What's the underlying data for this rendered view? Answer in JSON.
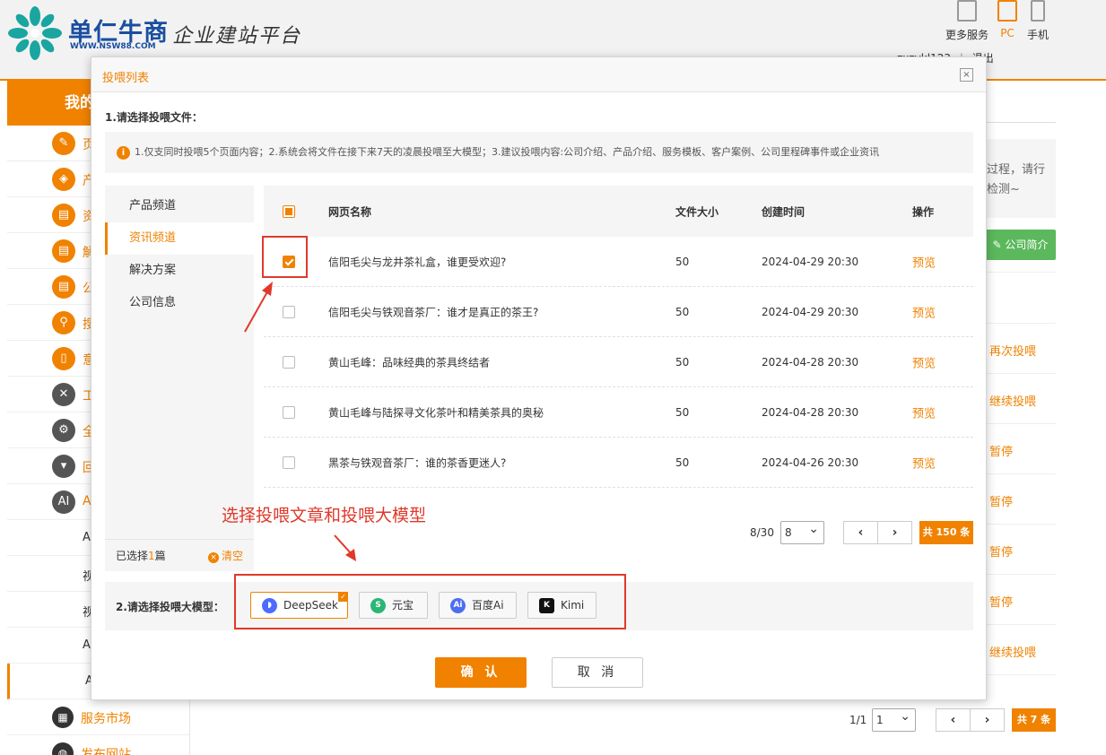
{
  "header": {
    "brand": "单仁牛商",
    "url": "WWW.NSW88.COM",
    "slogan": "企业建站平台",
    "devices": [
      {
        "label": "更多服务",
        "active": false
      },
      {
        "label": "PC",
        "active": true
      },
      {
        "label": "手机",
        "active": false
      }
    ],
    "user": "zxzykl123",
    "logout": "退出"
  },
  "sidebar": {
    "title": "我的",
    "items": [
      {
        "label": "页",
        "icon": "pencil-icon"
      },
      {
        "label": "产",
        "icon": "box-icon"
      },
      {
        "label": "资",
        "icon": "document-icon"
      },
      {
        "label": "解",
        "icon": "document-icon"
      },
      {
        "label": "公",
        "icon": "document-icon"
      },
      {
        "label": "搜",
        "icon": "search-icon"
      },
      {
        "label": "意",
        "icon": "file-icon"
      },
      {
        "label": "工",
        "icon": "wrench-icon"
      },
      {
        "label": "全",
        "icon": "gear-icon"
      },
      {
        "label": "回",
        "icon": "trash-icon"
      },
      {
        "label": "A",
        "icon": "ai-icon"
      }
    ],
    "subitems": [
      "A",
      "视",
      "视",
      "A",
      "A"
    ],
    "footer": [
      {
        "label": "服务市场",
        "icon": "grid-icon"
      },
      {
        "label": "发布网站",
        "icon": "globe-icon"
      }
    ]
  },
  "background": {
    "notice": "过程，请行检测~",
    "green_button": "公司简介",
    "actions": [
      "再次投喂",
      "继续投喂",
      "暂停",
      "暂停",
      "暂停",
      "暂停",
      "继续投喂"
    ],
    "pager": {
      "page": "1/1",
      "select": "1",
      "total": "共 7 条"
    }
  },
  "modal": {
    "title": "投喂列表",
    "close": "×",
    "step1": "1.请选择投喂文件：",
    "tip": "1.仅支同时投喂5个页面内容；2.系统会将文件在接下来7天的凌晨投喂至大模型；3.建议投喂内容:公司介绍、产品介绍、服务模板、客户案例、公司里程碑事件或企业资讯",
    "categories": [
      {
        "label": "产品频道",
        "active": false
      },
      {
        "label": "资讯频道",
        "active": true
      },
      {
        "label": "解决方案",
        "active": false
      },
      {
        "label": "公司信息",
        "active": false
      }
    ],
    "selected_prefix": "已选择",
    "selected_count": "1",
    "selected_suffix": "篇",
    "clear": "清空",
    "columns": {
      "name": "网页名称",
      "size": "文件大小",
      "time": "创建时间",
      "op": "操作"
    },
    "rows": [
      {
        "name": "信阳毛尖与龙井茶礼盒，谁更受欢迎?",
        "size": "50",
        "time": "2024-04-29 20:30",
        "op": "预览",
        "checked": true
      },
      {
        "name": "信阳毛尖与铁观音茶厂：谁才是真正的茶王?",
        "size": "50",
        "time": "2024-04-29 20:30",
        "op": "预览",
        "checked": false
      },
      {
        "name": "黄山毛峰：品味经典的茶具终结者",
        "size": "50",
        "time": "2024-04-28 20:30",
        "op": "预览",
        "checked": false
      },
      {
        "name": "黄山毛峰与陆探寻文化茶叶和精美茶具的奥秘",
        "size": "50",
        "time": "2024-04-28 20:30",
        "op": "预览",
        "checked": false
      },
      {
        "name": "黑茶与铁观音茶厂：谁的茶香更迷人?",
        "size": "50",
        "time": "2024-04-26 20:30",
        "op": "预览",
        "checked": false
      }
    ],
    "pager": {
      "page": "8/30",
      "select": "8",
      "total": "共 150 条"
    },
    "step2": "2.请选择投喂大模型：",
    "models": [
      {
        "label": "DeepSeek",
        "selected": true,
        "color": "#4d6bfe"
      },
      {
        "label": "元宝",
        "selected": false,
        "color": "#2bb673"
      },
      {
        "label": "百度Ai",
        "selected": false,
        "color": "#4e6ef2"
      },
      {
        "label": "Kimi",
        "selected": false,
        "color": "#111111"
      }
    ],
    "confirm": "确 认",
    "cancel": "取 消"
  },
  "annotation": {
    "text": "选择投喂文章和投喂大模型",
    "color": "#e0392b"
  }
}
